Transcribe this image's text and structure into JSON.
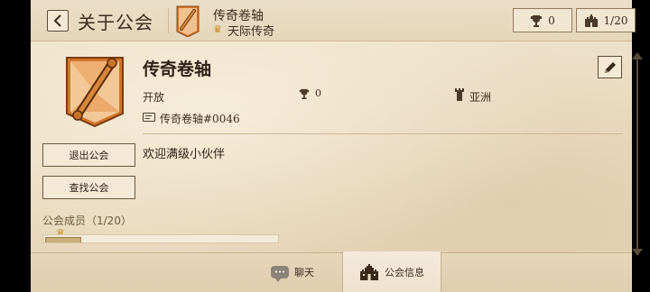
{
  "header": {
    "title": "关于公会",
    "guild_name": "传奇卷轴",
    "guild_rank": "天际传奇",
    "trophy_count": "0",
    "member_count": "1/20"
  },
  "guild": {
    "name": "传奇卷轴",
    "status": "开放",
    "trophies": "0",
    "region": "亚洲",
    "tag": "传奇卷轴#0046",
    "description": "欢迎满级小伙伴"
  },
  "buttons": {
    "leave": "退出公会",
    "find": "查找公会"
  },
  "members": {
    "label": "公会成员（1/20）"
  },
  "tabs": [
    {
      "label": "聊天",
      "icon": "chat-bubble-icon"
    },
    {
      "label": "公会信息",
      "icon": "castle-icon"
    }
  ],
  "colors": {
    "parchment": "#ebdcc2",
    "emblem_orange": "#d4752a",
    "crown_gold": "#c98a1a",
    "text_dark": "#2f2216"
  }
}
